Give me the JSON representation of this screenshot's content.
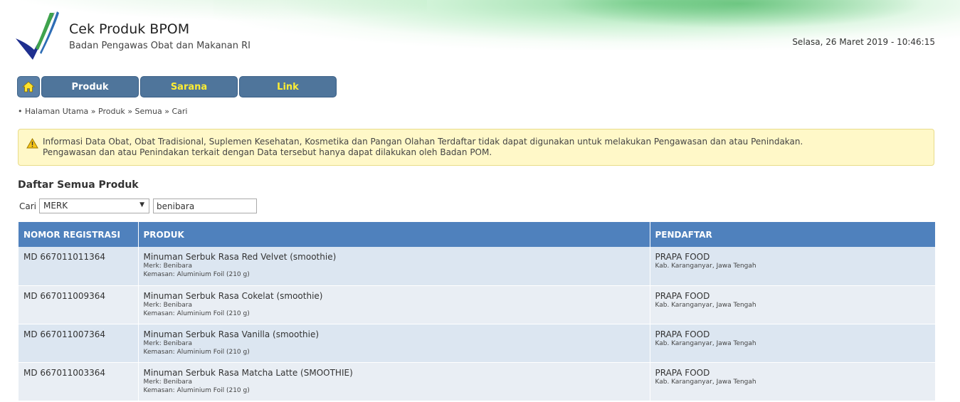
{
  "header": {
    "title": "Cek Produk BPOM",
    "subtitle": "Badan Pengawas Obat dan Makanan RI",
    "datetime": "Selasa, 26 Maret 2019 - 10:46:15"
  },
  "nav": {
    "home_icon": "home-icon",
    "items": [
      {
        "label": "Produk",
        "color": "#ffffff"
      },
      {
        "label": "Sarana",
        "color": "#ffee33"
      },
      {
        "label": "Link",
        "color": "#ffee33"
      }
    ]
  },
  "breadcrumb": {
    "bullet": "•",
    "items": [
      "Halaman Utama",
      "Produk",
      "Semua",
      "Cari"
    ],
    "separator": "»"
  },
  "alert": {
    "icon": "warning-icon",
    "line1": "Informasi Data Obat, Obat Tradisional, Suplemen Kesehatan, Kosmetika dan Pangan Olahan Terdaftar tidak dapat digunakan untuk melakukan Pengawasan dan atau Penindakan.",
    "line2": "Pengawasan dan atau Penindakan terkait dengan Data tersebut hanya dapat dilakukan oleh Badan POM."
  },
  "section_title": "Daftar Semua Produk",
  "search": {
    "label": "Cari",
    "select_value": "MERK",
    "input_value": "benibara"
  },
  "table": {
    "headers": [
      "NOMOR REGISTRASI",
      "PRODUK",
      "PENDAFTAR"
    ],
    "rows": [
      {
        "reg": "MD 667011011364",
        "product": "Minuman Serbuk Rasa Red Velvet (smoothie)",
        "merk": "Merk: Benibara",
        "kemasan": "Kemasan: Aluminium Foil (210 g)",
        "pendaftar": "PRAPA FOOD",
        "lokasi": "Kab. Karanganyar, Jawa Tengah"
      },
      {
        "reg": "MD 667011009364",
        "product": "Minuman Serbuk Rasa Cokelat (smoothie)",
        "merk": "Merk: Benibara",
        "kemasan": "Kemasan: Aluminium Foil (210 g)",
        "pendaftar": "PRAPA FOOD",
        "lokasi": "Kab. Karanganyar, Jawa Tengah"
      },
      {
        "reg": "MD 667011007364",
        "product": "Minuman Serbuk Rasa Vanilla (smoothie)",
        "merk": "Merk: Benibara",
        "kemasan": "Kemasan: Aluminium Foil (210 g)",
        "pendaftar": "PRAPA FOOD",
        "lokasi": "Kab. Karanganyar, Jawa Tengah"
      },
      {
        "reg": "MD 667011003364",
        "product": "Minuman Serbuk Rasa Matcha Latte (SMOOTHIE)",
        "merk": "Merk: Benibara",
        "kemasan": "Kemasan: Aluminium Foil (210 g)",
        "pendaftar": "PRAPA FOOD",
        "lokasi": "Kab. Karanganyar, Jawa Tengah"
      }
    ]
  },
  "colors": {
    "nav_bg": "#4f759b",
    "table_header": "#4f81bd",
    "row_odd": "#dce6f1",
    "row_even": "#e9eef4",
    "alert_bg": "#fff8c8"
  }
}
